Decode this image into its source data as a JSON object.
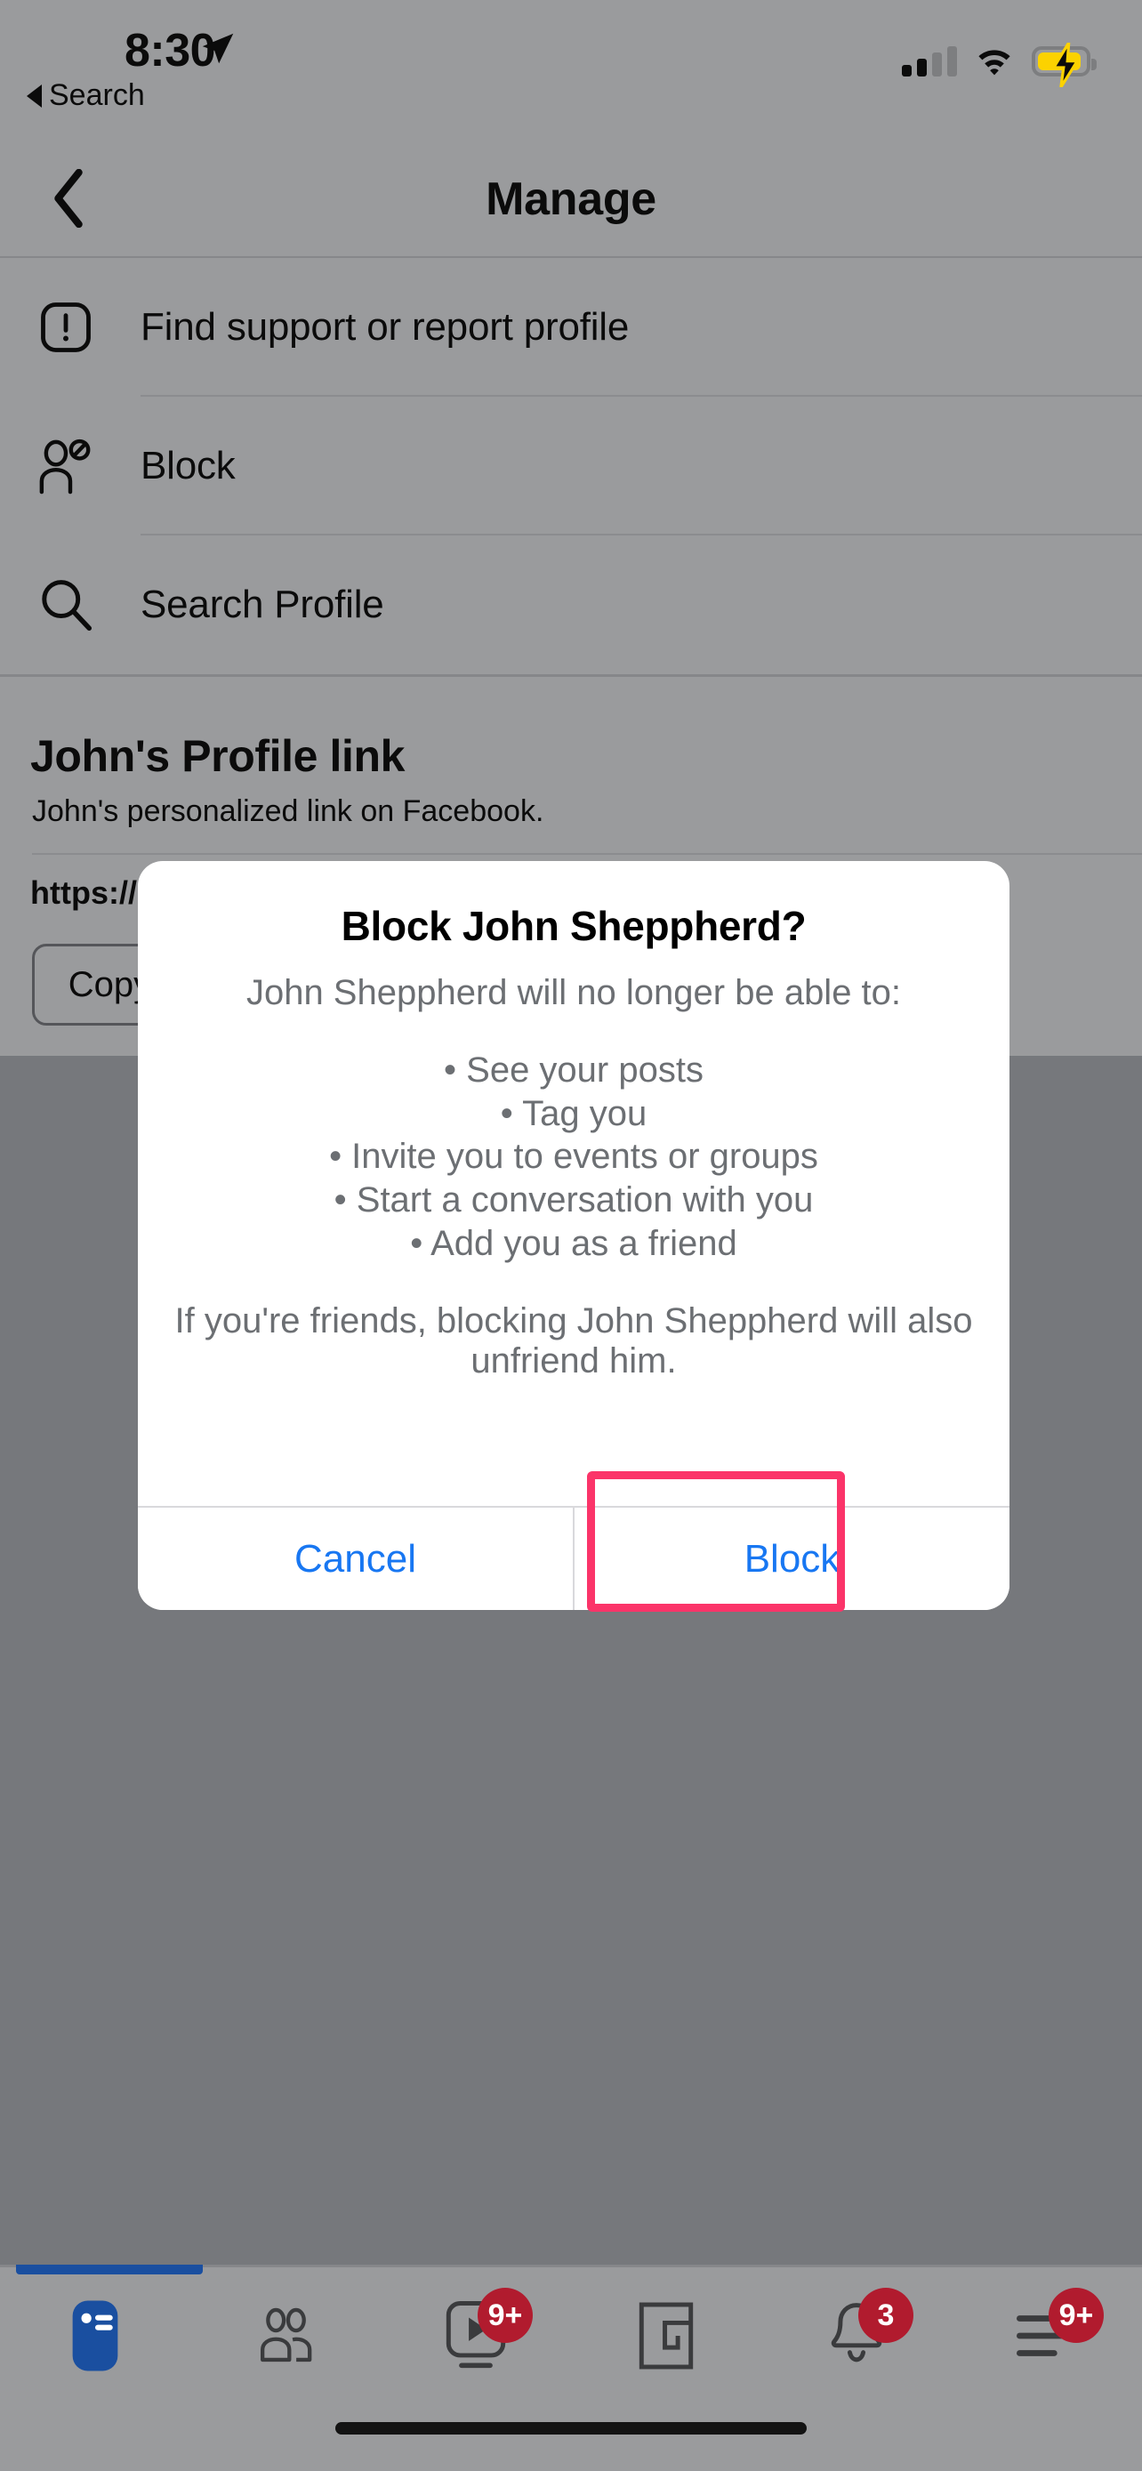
{
  "status_bar": {
    "time": "8:30",
    "location_icon": "location-arrow-icon",
    "signal_icon": "cellular-signal-icon",
    "signal_bars_filled": 2,
    "signal_bars_total": 4,
    "wifi_icon": "wifi-icon",
    "battery_icon": "battery-charging-icon",
    "battery_color": "#fcd200",
    "back_app_label": "Search"
  },
  "navbar": {
    "back_icon": "chevron-left-icon",
    "title": "Manage"
  },
  "menu": {
    "items": [
      {
        "label": "Find support or report profile",
        "icon": "exclamation-square-icon"
      },
      {
        "label": "Block",
        "icon": "person-block-icon"
      },
      {
        "label": "Search Profile",
        "icon": "search-icon"
      }
    ]
  },
  "profile_link": {
    "heading": "John's Profile link",
    "description": "John's personalized link on Facebook.",
    "url": "https://",
    "copy_label": "Copy"
  },
  "dialog": {
    "title": "Block John Sheppherd?",
    "subtitle": "John Sheppherd will no longer be able to:",
    "bullets": [
      "• See your posts",
      "• Tag you",
      "• Invite you to events or groups",
      "• Start a conversation with you",
      "• Add you as a friend"
    ],
    "footer": "If you're friends, blocking John Sheppherd will also unfriend him.",
    "cancel_label": "Cancel",
    "confirm_label": "Block",
    "confirm_highlight_color": "#fb3469",
    "button_text_color": "#1877f2"
  },
  "bottom_nav": {
    "active_indicator_color": "#1a4fa0",
    "badge_color": "#b11b2e",
    "items": [
      {
        "name": "news-feed",
        "icon": "news-feed-icon",
        "badge": "",
        "active": true
      },
      {
        "name": "friends",
        "icon": "friends-icon",
        "badge": "",
        "active": false
      },
      {
        "name": "watch",
        "icon": "watch-video-icon",
        "badge": "9+",
        "active": false
      },
      {
        "name": "marketplace",
        "icon": "marketplace-icon",
        "badge": "",
        "active": false
      },
      {
        "name": "notifications",
        "icon": "bell-icon",
        "badge": "3",
        "active": false
      },
      {
        "name": "menu",
        "icon": "hamburger-menu-icon",
        "badge": "9+",
        "active": false
      }
    ]
  }
}
